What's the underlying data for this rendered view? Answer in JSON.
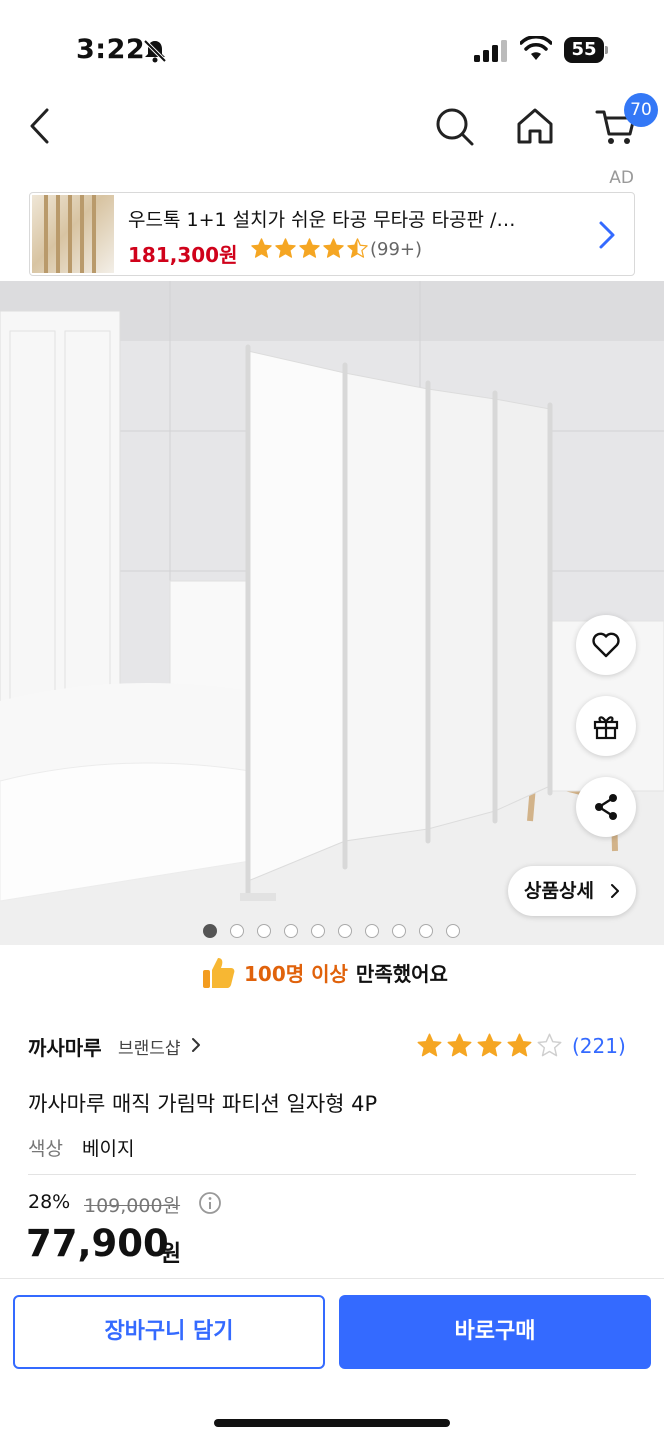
{
  "status_bar": {
    "time": "3:22",
    "battery": "55"
  },
  "nav": {
    "cart_badge": "70"
  },
  "ad": {
    "label": "AD",
    "title": "우드톡 1+1 설치가 쉬운 타공 무타공 타공판 /…",
    "price": "181,300원",
    "rating": 4.5,
    "review_count": "(99+)"
  },
  "gallery": {
    "detail_button": "상품상세",
    "page_count": 10,
    "active_page": 1
  },
  "satisfaction": {
    "count": "100명 이상",
    "text": "만족했어요"
  },
  "product": {
    "brand": "까사마루",
    "brand_shop": "브랜드샵",
    "rating": 4,
    "rating_count": "(221)",
    "title": "까사마루 매직 가림막 파티션 일자형 4P",
    "option_label": "색상",
    "option_value": "베이지",
    "discount": "28%",
    "original_price": "109,000원",
    "price": "77,900",
    "price_unit": "원"
  },
  "bottom": {
    "cart_button": "장바구니 담기",
    "buy_button": "바로구매"
  },
  "colors": {
    "accent": "#346aff",
    "ad_price": "#d0021b",
    "satisfaction": "#e0620b",
    "star": "#f5a623"
  }
}
